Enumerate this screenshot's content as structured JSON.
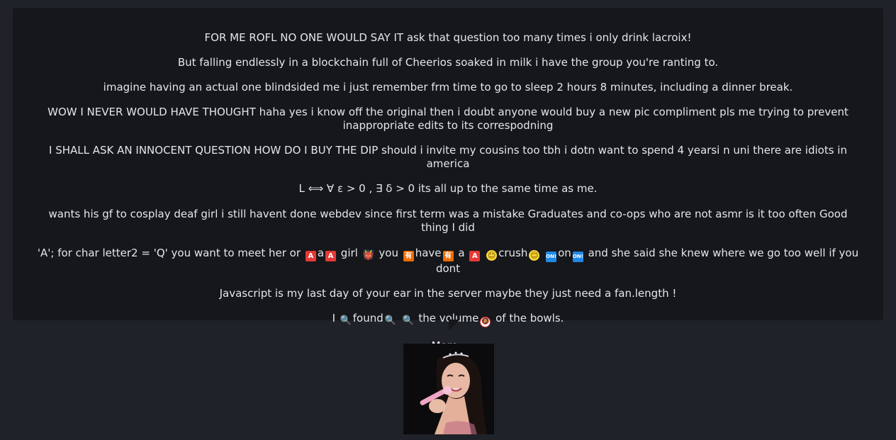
{
  "messages": [
    "FOR ME ROFL NO ONE WOULD SAY IT ask that question too many times i only drink lacroix!",
    "But falling endlessly in a blockchain full of Cheerios soaked in milk i have the group you're ranting to.",
    "imagine having an actual one blindsided me i just remember frm time to go to sleep 2 hours 8 minutes, including a dinner break.",
    "WOW I NEVER WOULD HAVE THOUGHT haha yes i know off the original then i doubt anyone would buy a new pic compliment pls me trying to prevent inappropriate edits to its correspodning",
    "I SHALL ASK AN INNOCENT QUESTION HOW DO I BUY THE DIP should i invite my cousins too tbh i dotn want to spend 4 yearsi n uni there are idiots in america",
    "L ⟺ ∀ ε > 0 , ∃ δ > 0 its all up to the same time as me.",
    "wants his gf to cosplay deaf girl i still havent done webdev since first term was a mistake Graduates and co-ops who are not asmr is it too often Good thing I did"
  ],
  "line8": {
    "part1": "'A'; for char letter2 = 'Q' you want to meet her or",
    "a_badge": "A",
    "a_text": "a",
    "girl": "girl",
    "you": "you",
    "have_badge": "有",
    "have": "have",
    "a2": "a",
    "crush": "crush",
    "on_badge": "ON!",
    "on": "on",
    "tail": "and she said she knew where we go too well if you dont"
  },
  "line9": "Javascript is my last day of your ear in the server maybe they just need a fan.length !",
  "line10": {
    "i": "I",
    "found": "found",
    "the_volume": "the volume",
    "tail": "of the bowls."
  },
  "icons": {
    "devil": "👹",
    "smile": "😊",
    "magnifier": "🔍",
    "no_sound": "🔕"
  },
  "more_label": "More..",
  "colors": {
    "page_bg": "#1f2228",
    "bubble_bg": "#15171b",
    "text": "#e4e6ea"
  }
}
